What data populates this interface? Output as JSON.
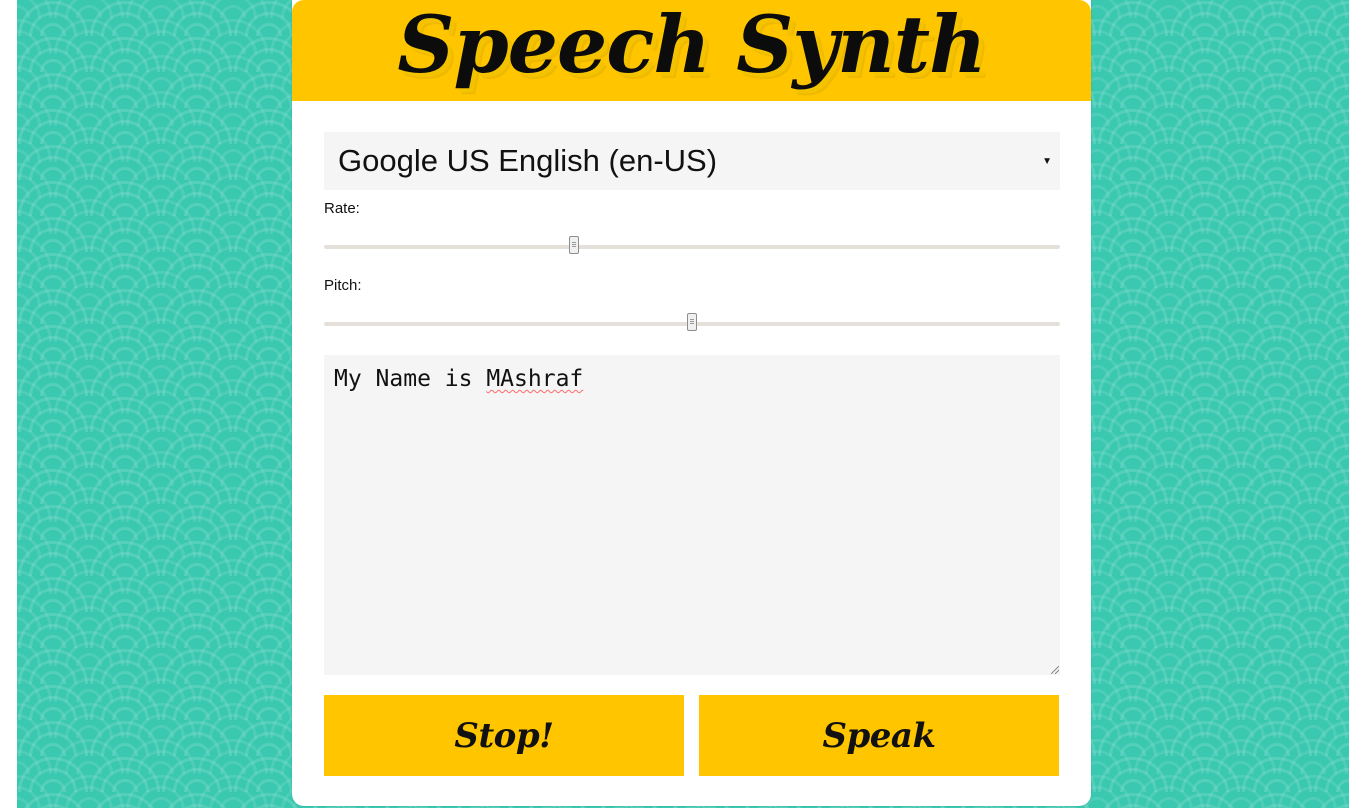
{
  "header": {
    "title": "Speech Synth"
  },
  "voice_selector": {
    "selected_voice": "Google US English (en-US)"
  },
  "controls": {
    "rate_label": "Rate:",
    "pitch_label": "Pitch:",
    "rate_value_percent": 34,
    "pitch_value_percent": 50
  },
  "message": {
    "prefix": "My Name is ",
    "misspelled_word": "MAshraf"
  },
  "buttons": {
    "stop_label": "Stop!",
    "speak_label": "Speak"
  },
  "colors": {
    "background": "#3bc8b0",
    "accent": "#ffc600",
    "panel": "#ffffff",
    "field": "#f5f5f5",
    "text": "#111111"
  },
  "icons": {
    "select_arrow": "chevron-down-icon",
    "resize_grip": "resize-grip-icon"
  }
}
